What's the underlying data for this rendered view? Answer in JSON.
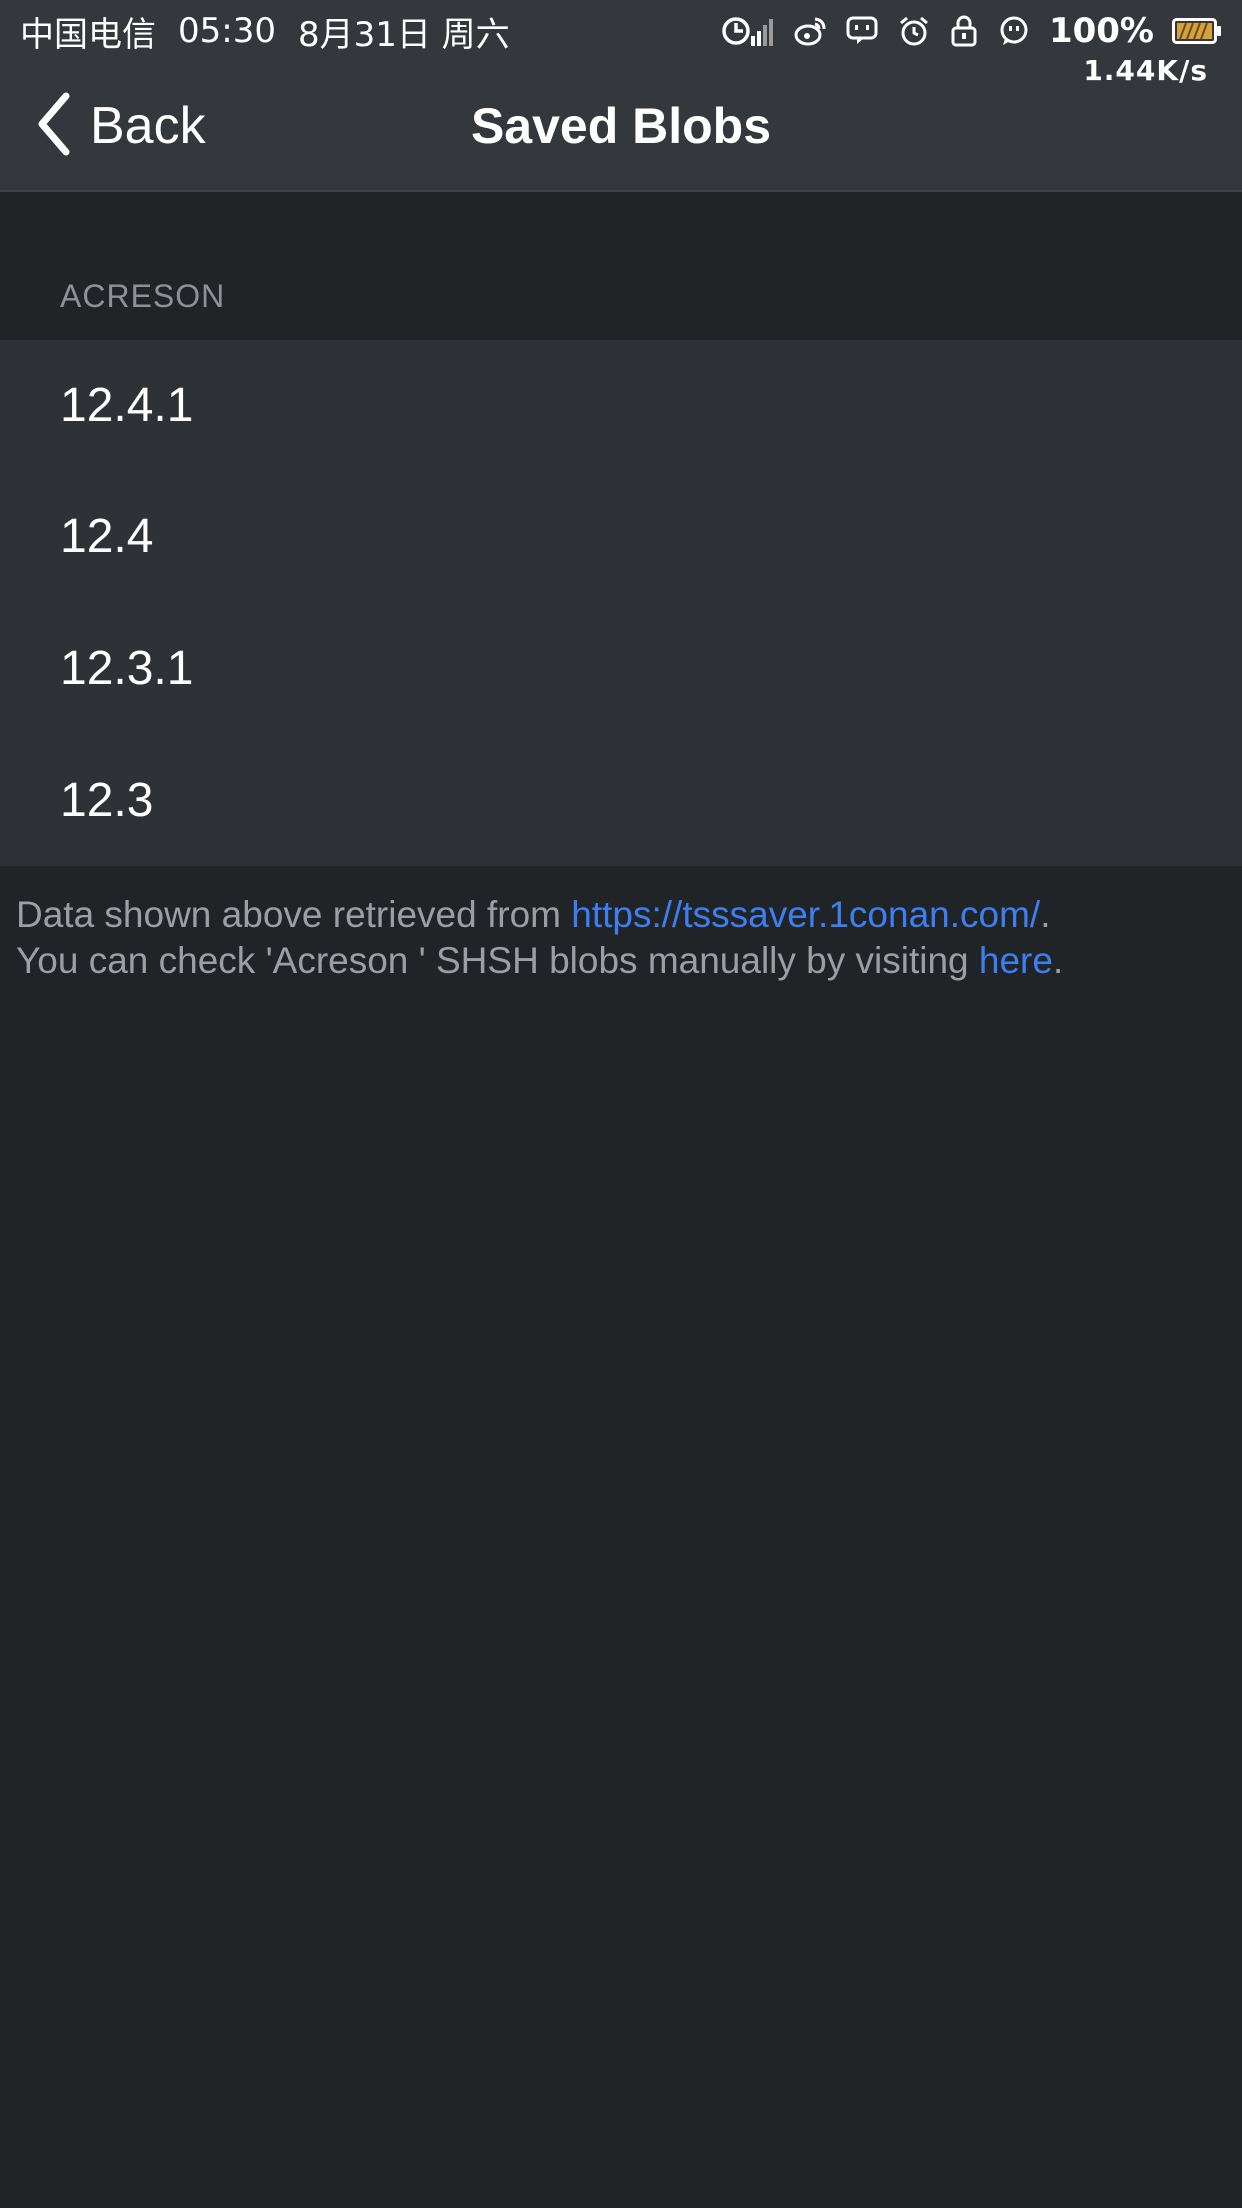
{
  "status_bar": {
    "carrier": "中国电信",
    "time": "05:30",
    "date": "8月31日 周六",
    "battery": "100%",
    "net_speed": "1.44K/s",
    "icons": [
      "wifi-signal-icon",
      "weibo-icon",
      "chat-icon",
      "alarm-icon",
      "lock-icon",
      "message-icon",
      "battery-icon"
    ]
  },
  "nav": {
    "back_label": "Back",
    "title": "Saved Blobs"
  },
  "section": {
    "header": "ACRESON",
    "items": [
      "12.4.1",
      "12.4",
      "12.3.1",
      "12.3"
    ]
  },
  "footer": {
    "line1_prefix": "Data shown above retrieved from ",
    "line1_link": "https://tsssaver.1conan.com/",
    "line1_suffix": ".",
    "line2_prefix": "You can check 'Acreson ' SHSH blobs manually by visiting ",
    "line2_link": "here",
    "line2_suffix": "."
  },
  "colors": {
    "background": "#212427",
    "bar": "#34373b",
    "list": "#2e3135",
    "link": "#3d7ff0",
    "secondary_text": "#9b9fa3"
  }
}
